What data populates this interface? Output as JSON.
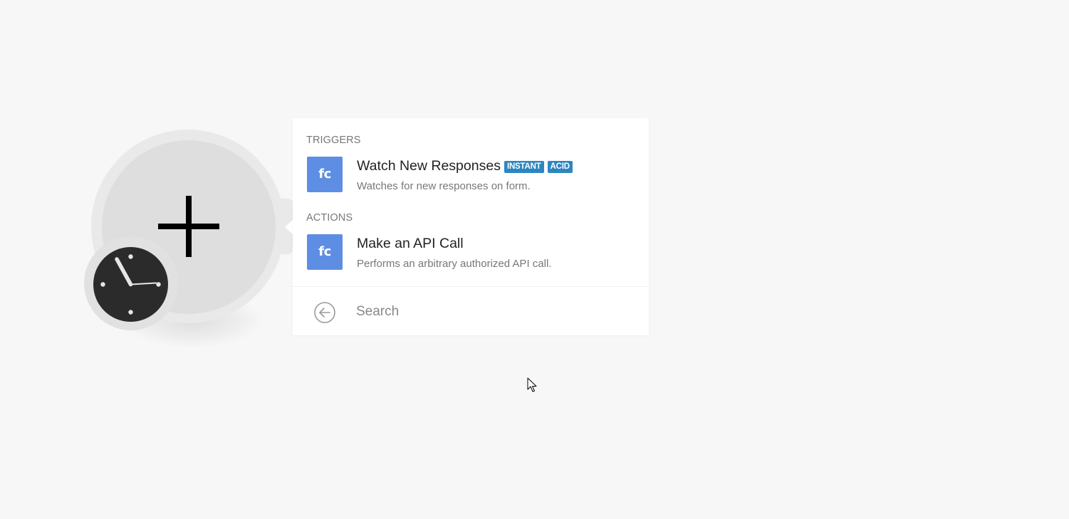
{
  "module": {
    "add_icon": "plus-icon",
    "schedule_icon": "clock-icon"
  },
  "menu": {
    "triggers_header": "TRIGGERS",
    "actions_header": "ACTIONS",
    "triggers": [
      {
        "icon_text": "fc",
        "title": "Watch New Responses",
        "badges": [
          "INSTANT",
          "ACID"
        ],
        "description": "Watches for new responses on form."
      }
    ],
    "actions": [
      {
        "icon_text": "fc",
        "title": "Make an API Call",
        "description": "Performs an arbitrary authorized API call."
      }
    ],
    "search": {
      "placeholder": "Search",
      "value": ""
    }
  },
  "colors": {
    "background": "#f7f7f7",
    "app_icon": "#5e8ee3",
    "badge": "#2e86c1",
    "module_inner": "#dedede",
    "clock_face": "#2b2b2b"
  }
}
